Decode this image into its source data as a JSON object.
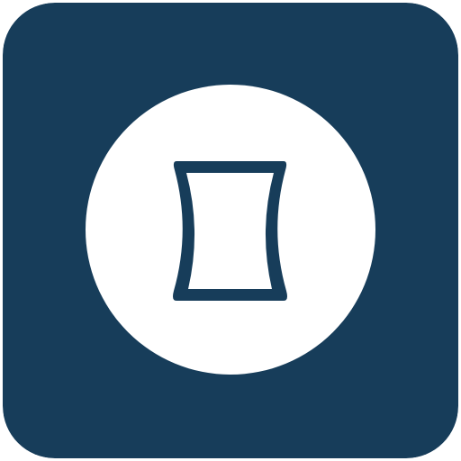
{
  "icon": {
    "name": "concave-frame-icon",
    "colors": {
      "background": "#173d5a",
      "circle": "#ffffff",
      "glyph": "#173d5a"
    }
  }
}
